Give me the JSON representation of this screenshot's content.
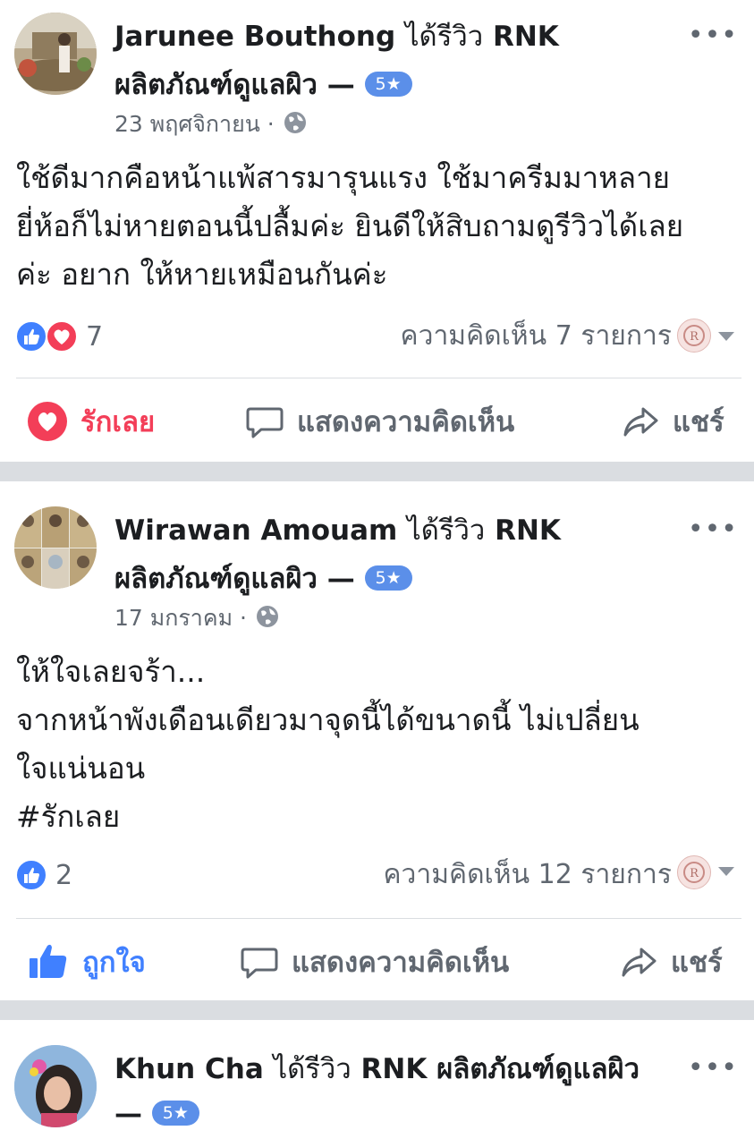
{
  "posts": [
    {
      "author": "Jarunee Bouthong",
      "verb": "ได้รีวิว",
      "page": "RNK",
      "page_line2": "ผลิตภัณฑ์ดูแลผิว —",
      "rating": "5★",
      "date": "23 พฤศจิกายน ·",
      "text": [
        "ใช้ดีมากคือหน้าแพ้สารมารุนแรง ใช้มาครีมมาหลาย",
        "ยี่ห้อก็ไม่หายตอนนี้ปลื้มค่ะ ยินดีให้สิบถามดูรีวิวได้เลย",
        "ค่ะ อยาก ให้หายเหมือนกันค่ะ"
      ],
      "reaction_count": "7",
      "comments": "ความคิดเห็น 7 รายการ",
      "actions": {
        "react": "รักเลย",
        "comment": "แสดงความคิดเห็น",
        "share": "แชร์"
      }
    },
    {
      "author": "Wirawan Amouam",
      "verb": "ได้รีวิว",
      "page": "RNK",
      "page_line2": "ผลิตภัณฑ์ดูแลผิว —",
      "rating": "5★",
      "date": "17 มกราคม ·",
      "text": [
        "ให้ใจเลยจร้า...",
        "จากหน้าพังเดือนเดียวมาจุดนี้ได้ขนาดนี้  ไม่เปลี่ยน",
        "ใจแน่นอน",
        "#รักเลย"
      ],
      "reaction_count": "2",
      "comments": "ความคิดเห็น 12 รายการ",
      "actions": {
        "react": "ถูกใจ",
        "comment": "แสดงความคิดเห็น",
        "share": "แชร์"
      }
    },
    {
      "author": "Khun Cha",
      "verb": "ได้รีวิว",
      "page": "RNK ผลิตภัณฑ์ดูแลผิว",
      "page_line2": "—",
      "rating": "5★"
    }
  ],
  "colors": {
    "like_blue": "#4080ff",
    "love_red": "#f33e58",
    "badge_blue": "#5b8fe9",
    "meta_gray": "#606770"
  },
  "icons": [
    "like-icon",
    "love-icon",
    "comment-icon",
    "share-icon",
    "globe-icon",
    "more-icon"
  ]
}
